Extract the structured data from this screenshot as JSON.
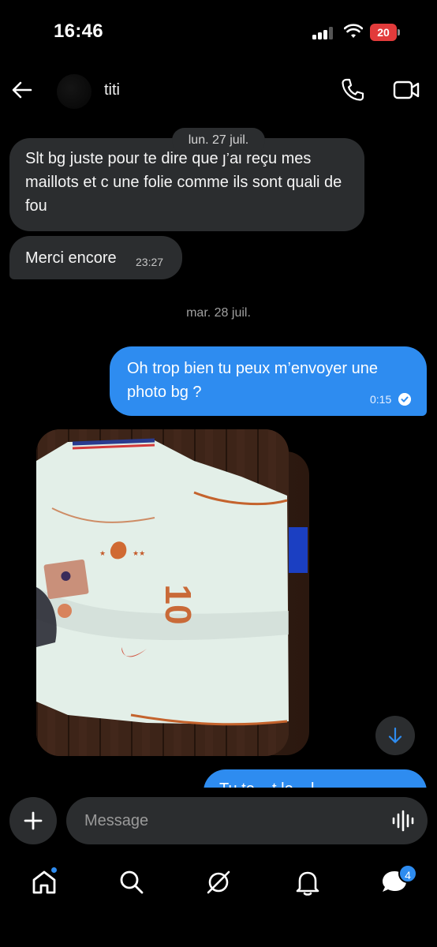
{
  "status_bar": {
    "time": "16:46",
    "battery": "20"
  },
  "header": {
    "contact_name": "titi",
    "icons": [
      "back-arrow-icon",
      "phone-icon",
      "video-camera-icon"
    ]
  },
  "conversation": {
    "date_1": "lun. 27 juil.",
    "date_2": "mar. 28 juil.",
    "messages": [
      {
        "direction": "incoming",
        "text": "Slt bg juste pour te dire que j’ai reçu mes maillots et c une folie comme ils sont quali de fou",
        "time": ""
      },
      {
        "direction": "incoming",
        "text": "Merci encore",
        "time": "23:27"
      },
      {
        "direction": "outgoing",
        "text": "Oh trop bien tu peux m’envoyer une photo bg ?",
        "time": "0:15",
        "status": "read"
      },
      {
        "direction": "incoming",
        "type": "photo"
      },
      {
        "direction": "outgoing",
        "text": "Tu te ...t le ...l..."
      }
    ]
  },
  "photo": {
    "jersey_number": "10"
  },
  "composer": {
    "placeholder": "Message"
  },
  "tab_bar": {
    "items": [
      "home-icon",
      "search-icon",
      "grok-icon",
      "notifications-icon",
      "messages-icon"
    ],
    "messages_badge": "4"
  },
  "colors": {
    "accent": "#2e8cf0",
    "bubble_incoming": "#2b2d2f",
    "background": "#000000",
    "battery_low": "#e23b3b"
  }
}
